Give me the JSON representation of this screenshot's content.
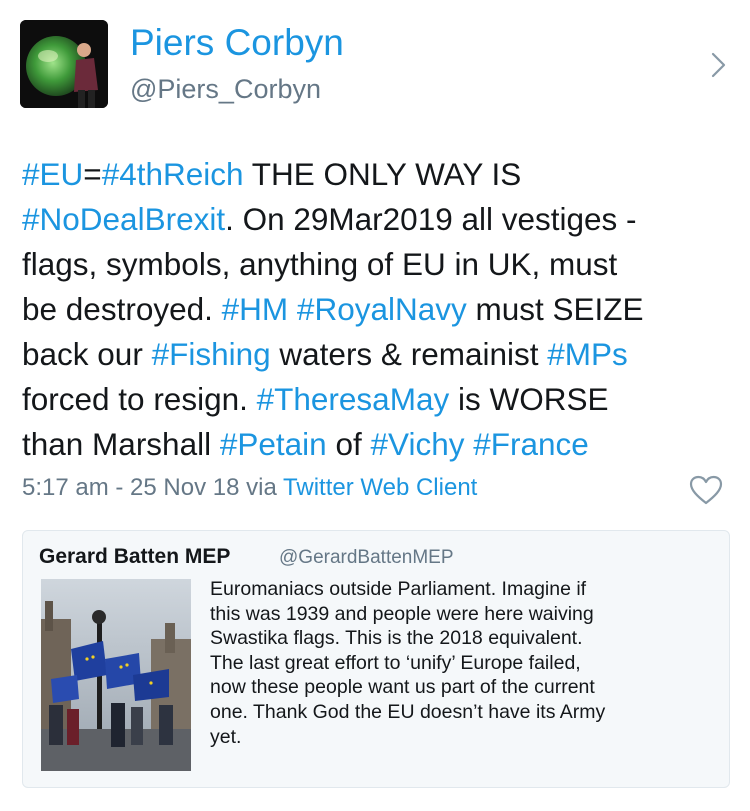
{
  "author": {
    "display_name": "Piers Corbyn",
    "handle": "@Piers_Corbyn"
  },
  "tweet": {
    "lines": [
      [
        {
          "t": "#EU",
          "h": true
        },
        {
          "t": "=",
          "h": false
        },
        {
          "t": "#4thReich",
          "h": true
        },
        {
          "t": " THE ONLY WAY IS",
          "h": false
        }
      ],
      [
        {
          "t": "#NoDealBrexit",
          "h": true
        },
        {
          "t": ". On 29Mar2019 all vestiges -",
          "h": false
        }
      ],
      [
        {
          "t": "flags, symbols, anything of EU in UK, must",
          "h": false
        }
      ],
      [
        {
          "t": "be destroyed. ",
          "h": false
        },
        {
          "t": "#HM",
          "h": true
        },
        {
          "t": " ",
          "h": false
        },
        {
          "t": "#RoyalNavy",
          "h": true
        },
        {
          "t": " must SEIZE",
          "h": false
        }
      ],
      [
        {
          "t": "back our ",
          "h": false
        },
        {
          "t": "#Fishing",
          "h": true
        },
        {
          "t": " waters & remainist ",
          "h": false
        },
        {
          "t": "#MPs",
          "h": true
        }
      ],
      [
        {
          "t": "forced to resign. ",
          "h": false
        },
        {
          "t": "#TheresaMay",
          "h": true
        },
        {
          "t": " is WORSE",
          "h": false
        }
      ],
      [
        {
          "t": "than Marshall ",
          "h": false
        },
        {
          "t": "#Petain",
          "h": true
        },
        {
          "t": " of  ",
          "h": false
        },
        {
          "t": "#Vichy",
          "h": true
        },
        {
          "t": " ",
          "h": false
        },
        {
          "t": "#France",
          "h": true
        }
      ]
    ]
  },
  "meta": {
    "timestamp": "5:17 am - 25 Nov 18 via ",
    "client": "Twitter Web Client"
  },
  "quoted": {
    "name": "Gerard Batten MEP",
    "handle": "@GerardBattenMEP",
    "lines": [
      "Euromaniacs  outside Parliament. Imagine if",
      "this was 1939 and people were here waiving",
      "Swastika flags. This is the 2018 equivalent.",
      "The last great effort to ‘unify’ Europe failed,",
      "now these people want us part of the current",
      "one. Thank God the EU doesn’t have its Army",
      "yet."
    ]
  },
  "colors": {
    "link": "#1b95e0",
    "secondary_text": "#657786",
    "text": "#14171a",
    "card_background": "#f5f8fa"
  },
  "icons": {
    "chevron": "chevron-right-icon",
    "like": "heart-icon"
  }
}
